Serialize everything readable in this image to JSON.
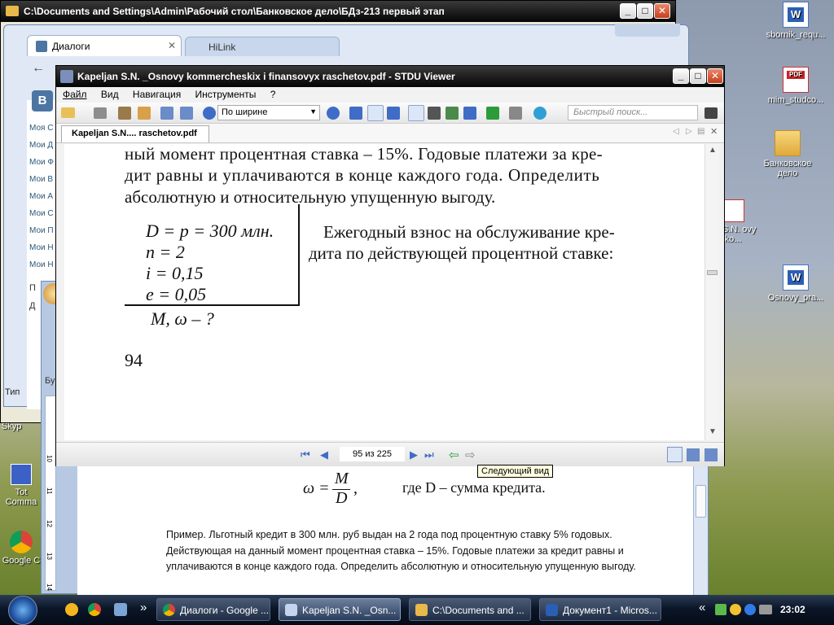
{
  "desktop_icons": [
    {
      "label": "sbornik_requ...",
      "kind": "word"
    },
    {
      "label": "mim_studco...",
      "kind": "pdf"
    },
    {
      "label": "Банковское дело",
      "kind": "folder"
    },
    {
      "label": "an S.N. ovy ko...",
      "kind": "pdf"
    },
    {
      "label": "Osnovy_pra...",
      "kind": "word"
    }
  ],
  "left_labels": {
    "skype": "Skyp",
    "total": "Tot Comma",
    "chrome": "Google C"
  },
  "explorer": {
    "title": "C:\\Documents and Settings\\Admin\\Рабочий стол\\Банковское дело\\БДз-213 первый этап"
  },
  "chrome_bg": {
    "tab1": "Диалоги",
    "tab2": "HiLink",
    "side_items": [
      "Моя С",
      "Мои Д",
      "Мои Ф",
      "Мои В",
      "Мои А",
      "Мои С",
      "Мои П",
      "Мои Н",
      "Мои Н"
    ],
    "letter_p": "П",
    "letter_d": "Д",
    "tip": "Тип",
    "bu": "Бу"
  },
  "word_doc": {
    "formula_lhs": "ω =",
    "numerator": "M",
    "denominator": "D",
    "comma": ",",
    "formula_rest": "где D – сумма кредита.",
    "paragraph": "Пример. Льготный кредит в 300  млн. руб выдан на 2 года под процентную ставку 5% годовых. Действующая на данный момент процентная ставка – 15%. Годовые платежи за  кредит равны и уплачиваются в конце каждого года. Определить абсолютную и относительную упущенную выгоду.",
    "ruler_marks": [
      "10",
      "11",
      "12",
      "13",
      "14"
    ]
  },
  "stdu": {
    "title": "Kapeljan S.N. _Osnovy kommercheskix i finansovyx raschetov.pdf - STDU Viewer",
    "menu": [
      "Файл",
      "Вид",
      "Навигация",
      "Инструменты",
      "?"
    ],
    "zoom_value": "По ширине",
    "search_placeholder": "Быстрый поиск...",
    "doc_tab": "Kapeljan S.N.... raschetov.pdf",
    "page_lines": [
      "ный момент процентная ставка – 15%. Годовые платежи за кре-",
      "дит равны и уплачиваются в конце каждого года. Определить",
      "абсолютную и относительную упущенную выгоду."
    ],
    "given": [
      "D = p = 300 млн.",
      "n = 2",
      "i = 0,15",
      "e = 0,05"
    ],
    "find": "M, ω – ?",
    "right_text": [
      "Ежегодный взнос на обслуживание кре-",
      "дита по действующей процентной ставке:"
    ],
    "page_number": "94",
    "page_indicator": "95 из 225",
    "tooltip": "Следующий вид"
  },
  "taskbar": {
    "buttons": [
      "Диалоги - Google ...",
      "Kapeljan S.N. _Osn...",
      "C:\\Documents and ...",
      "Документ1 - Micros..."
    ],
    "arrows": "»",
    "tray_arrows": "«",
    "clock": "23:02"
  },
  "colors": {
    "accent": "#3a77c8",
    "taskbar": "#0b1a2f"
  }
}
